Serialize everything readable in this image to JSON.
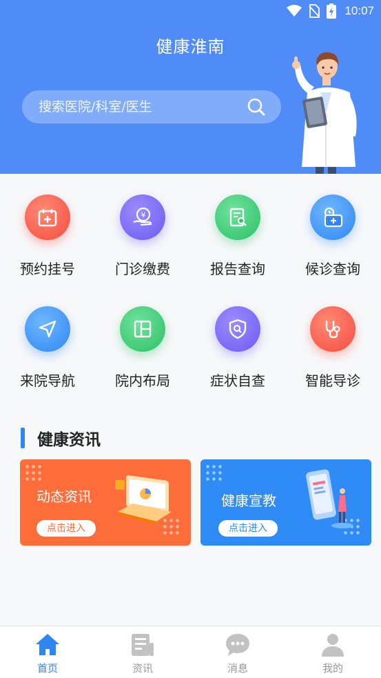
{
  "status_bar": {
    "time": "10:07",
    "icons": [
      "wifi-icon",
      "no-sim-icon",
      "battery-charging-icon"
    ]
  },
  "header": {
    "title": "健康淮南",
    "search": {
      "placeholder": "搜索医院/科室/医生",
      "value": ""
    },
    "illustration": "doctor-holding-clipboard"
  },
  "services": [
    {
      "label": "预约挂号",
      "icon": "calendar-plus-icon",
      "color": "#f54b3c"
    },
    {
      "label": "门诊缴费",
      "icon": "yuan-payment-icon",
      "color": "#6b5bf0"
    },
    {
      "label": "报告查询",
      "icon": "report-search-icon",
      "color": "#2ebf68"
    },
    {
      "label": "候诊查询",
      "icon": "clock-medical-icon",
      "color": "#2f86f3"
    },
    {
      "label": "来院导航",
      "icon": "navigation-arrow-icon",
      "color": "#2f86f3"
    },
    {
      "label": "院内布局",
      "icon": "layout-grid-icon",
      "color": "#2ebf68"
    },
    {
      "label": "症状自查",
      "icon": "shield-search-icon",
      "color": "#6b5bf0"
    },
    {
      "label": "智能导诊",
      "icon": "stethoscope-icon",
      "color": "#f54b3c"
    }
  ],
  "news_section": {
    "title": "健康资讯",
    "cards": [
      {
        "title": "动态资讯",
        "button": "点击进入",
        "color": "#ff6d3a",
        "illustration": "laptop-icon"
      },
      {
        "title": "健康宣教",
        "button": "点击进入",
        "color": "#2f8bf5",
        "illustration": "phone-person-icon"
      }
    ]
  },
  "tabbar": {
    "tabs": [
      {
        "label": "首页",
        "icon": "home-icon",
        "active": true
      },
      {
        "label": "资讯",
        "icon": "news-icon",
        "active": false
      },
      {
        "label": "消息",
        "icon": "message-icon",
        "active": false
      },
      {
        "label": "我的",
        "icon": "profile-icon",
        "active": false
      }
    ],
    "active_color": "#2f86f3",
    "inactive_color": "#999999"
  }
}
